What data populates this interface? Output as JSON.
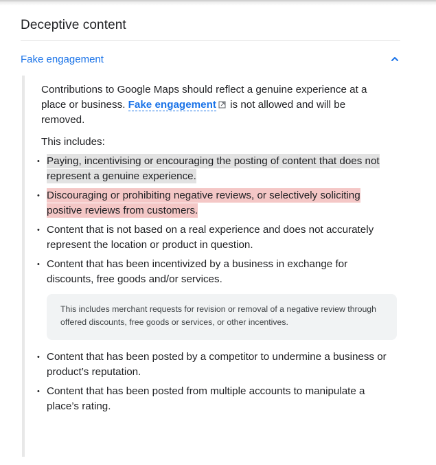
{
  "section": {
    "title": "Deceptive content"
  },
  "accordion": {
    "title": "Fake engagement",
    "expanded": true,
    "toggle_icon": "chevron-up-icon"
  },
  "content": {
    "intro_before": "Contributions to Google Maps should reflect a genuine experience at a place or business. ",
    "link_text": "Fake engagement",
    "link_icon": "external-link-icon",
    "intro_after": " is not allowed and will be removed.",
    "includes_label": "This includes:",
    "items": [
      {
        "text": "Paying, incentivising or encouraging the posting of content that does not represent a genuine experience.",
        "highlight": "gray"
      },
      {
        "text": "Discouraging or prohibiting negative reviews, or selectively soliciting positive reviews from customers.",
        "highlight": "red"
      },
      {
        "text": "Content that is not based on a real experience and does not accurately represent the location or product in question.",
        "highlight": "none"
      },
      {
        "text": "Content that has been incentivized by a business in exchange for discounts, free goods and/or services.",
        "highlight": "none"
      },
      {
        "text": "Content that has been posted by a competitor to undermine a business or product’s reputation.",
        "highlight": "none"
      },
      {
        "text": "Content that has been posted from multiple accounts to manipulate a place’s rating.",
        "highlight": "none"
      }
    ],
    "note": "This includes merchant requests for revision or removal of a negative review through offered discounts, free goods or services, or other incentives."
  },
  "colors": {
    "link": "#1a73e8",
    "highlight_gray": "#e2e2e2",
    "highlight_red": "#f4c7c6",
    "note_bg": "#f1f3f4"
  }
}
